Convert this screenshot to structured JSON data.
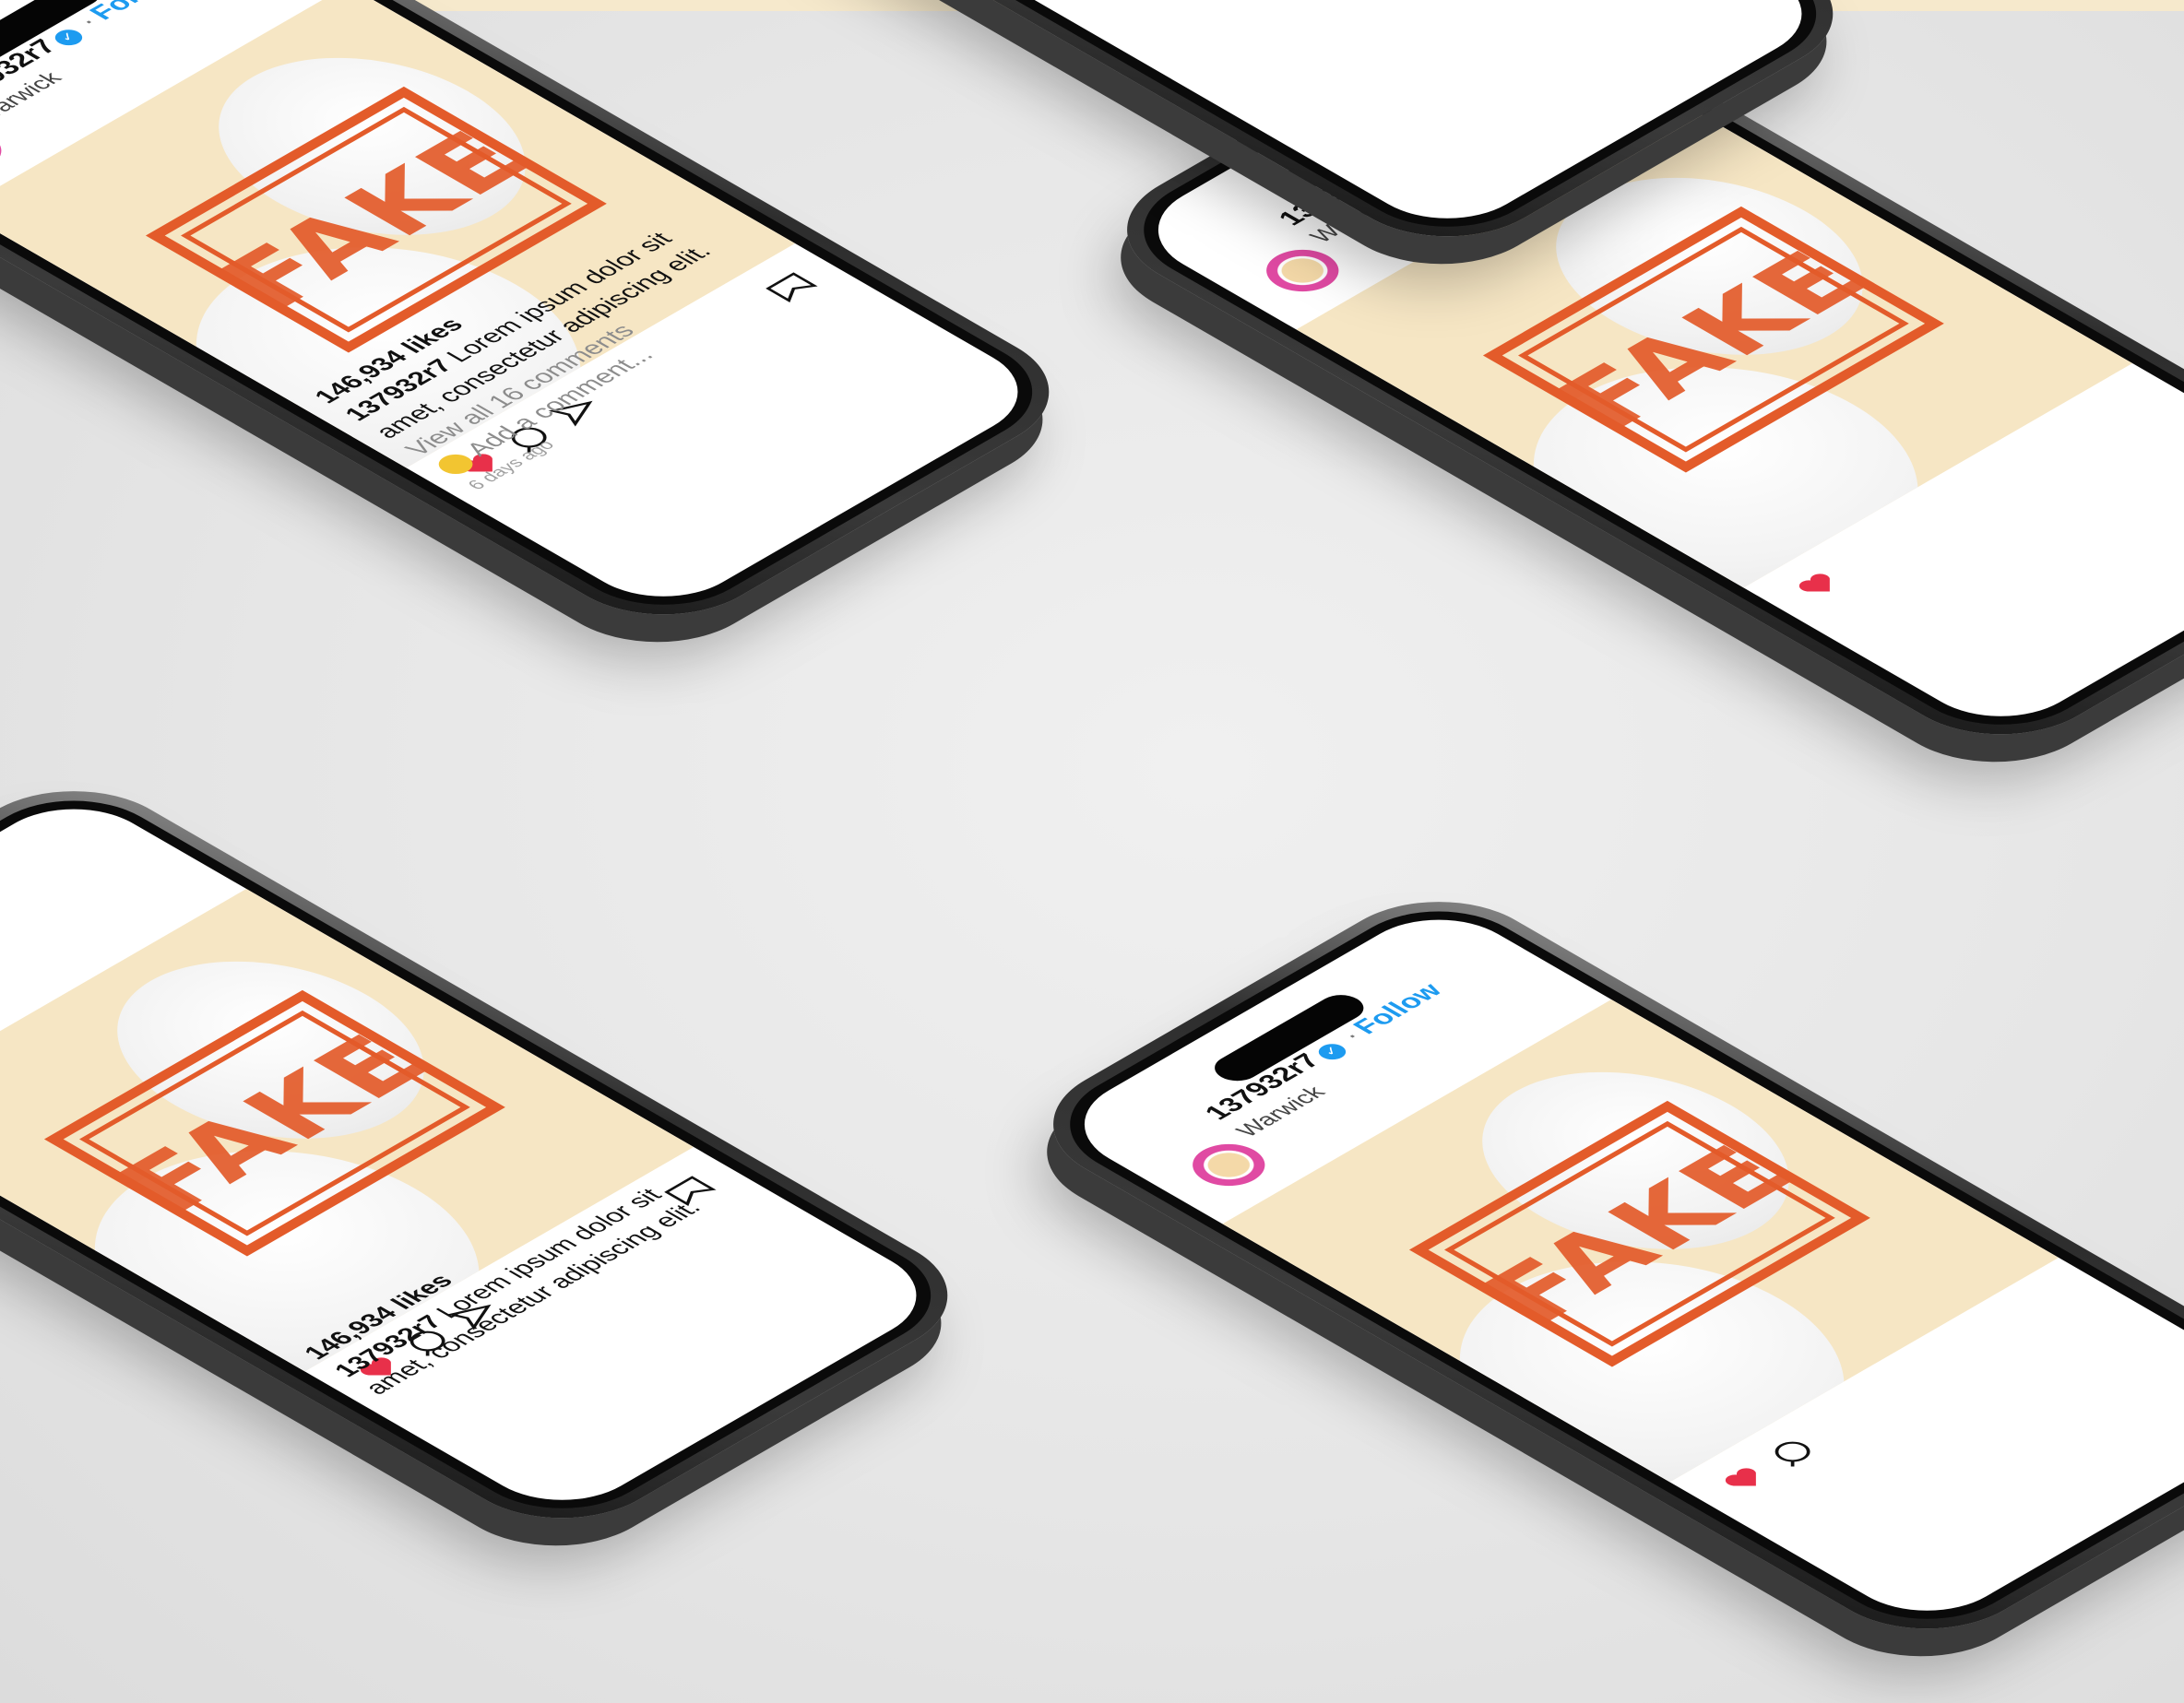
{
  "post": {
    "username": "137932r7",
    "verified_icon": "✓",
    "separator": "·",
    "follow_label": "Follow",
    "location": "Warwick",
    "stamp_text": "FAKE",
    "likes": "146,934 likes",
    "caption_user": "137932r7",
    "caption_text": "Lorem ipsum dolor sit amet, consectetur adipiscing elit.",
    "view_all": "View all 16 comments",
    "add_comment": "Add a comment...",
    "time_ago": "6 days ago"
  },
  "colors": {
    "background": "#e4e4e4",
    "post_bg": "#f6e6c4",
    "stamp": "#e35b2a",
    "link_blue": "#1d9bf0",
    "like_red": "#e8304a"
  },
  "icons": [
    "heart-icon",
    "comment-icon",
    "share-icon",
    "bookmark-icon",
    "verified-badge-icon"
  ]
}
